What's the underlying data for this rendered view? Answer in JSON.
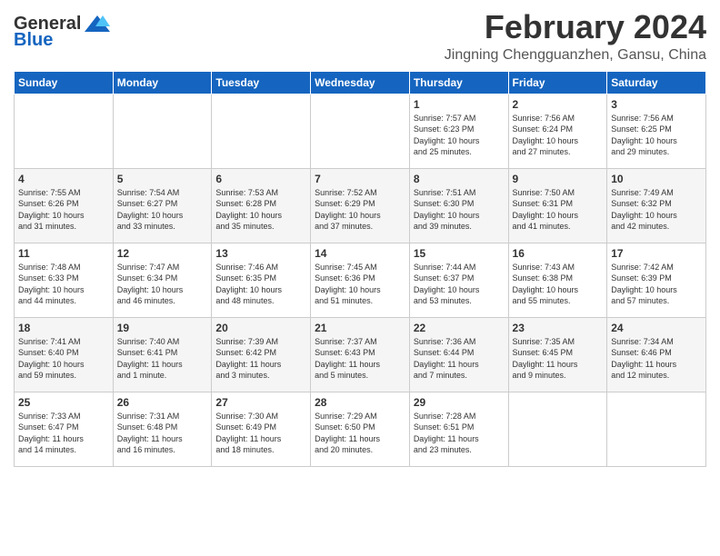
{
  "header": {
    "logo_line1": "General",
    "logo_line2": "Blue",
    "month_year": "February 2024",
    "location": "Jingning Chengguanzhen, Gansu, China"
  },
  "weekdays": [
    "Sunday",
    "Monday",
    "Tuesday",
    "Wednesday",
    "Thursday",
    "Friday",
    "Saturday"
  ],
  "weeks": [
    [
      {
        "day": "",
        "info": ""
      },
      {
        "day": "",
        "info": ""
      },
      {
        "day": "",
        "info": ""
      },
      {
        "day": "",
        "info": ""
      },
      {
        "day": "1",
        "info": "Sunrise: 7:57 AM\nSunset: 6:23 PM\nDaylight: 10 hours\nand 25 minutes."
      },
      {
        "day": "2",
        "info": "Sunrise: 7:56 AM\nSunset: 6:24 PM\nDaylight: 10 hours\nand 27 minutes."
      },
      {
        "day": "3",
        "info": "Sunrise: 7:56 AM\nSunset: 6:25 PM\nDaylight: 10 hours\nand 29 minutes."
      }
    ],
    [
      {
        "day": "4",
        "info": "Sunrise: 7:55 AM\nSunset: 6:26 PM\nDaylight: 10 hours\nand 31 minutes."
      },
      {
        "day": "5",
        "info": "Sunrise: 7:54 AM\nSunset: 6:27 PM\nDaylight: 10 hours\nand 33 minutes."
      },
      {
        "day": "6",
        "info": "Sunrise: 7:53 AM\nSunset: 6:28 PM\nDaylight: 10 hours\nand 35 minutes."
      },
      {
        "day": "7",
        "info": "Sunrise: 7:52 AM\nSunset: 6:29 PM\nDaylight: 10 hours\nand 37 minutes."
      },
      {
        "day": "8",
        "info": "Sunrise: 7:51 AM\nSunset: 6:30 PM\nDaylight: 10 hours\nand 39 minutes."
      },
      {
        "day": "9",
        "info": "Sunrise: 7:50 AM\nSunset: 6:31 PM\nDaylight: 10 hours\nand 41 minutes."
      },
      {
        "day": "10",
        "info": "Sunrise: 7:49 AM\nSunset: 6:32 PM\nDaylight: 10 hours\nand 42 minutes."
      }
    ],
    [
      {
        "day": "11",
        "info": "Sunrise: 7:48 AM\nSunset: 6:33 PM\nDaylight: 10 hours\nand 44 minutes."
      },
      {
        "day": "12",
        "info": "Sunrise: 7:47 AM\nSunset: 6:34 PM\nDaylight: 10 hours\nand 46 minutes."
      },
      {
        "day": "13",
        "info": "Sunrise: 7:46 AM\nSunset: 6:35 PM\nDaylight: 10 hours\nand 48 minutes."
      },
      {
        "day": "14",
        "info": "Sunrise: 7:45 AM\nSunset: 6:36 PM\nDaylight: 10 hours\nand 51 minutes."
      },
      {
        "day": "15",
        "info": "Sunrise: 7:44 AM\nSunset: 6:37 PM\nDaylight: 10 hours\nand 53 minutes."
      },
      {
        "day": "16",
        "info": "Sunrise: 7:43 AM\nSunset: 6:38 PM\nDaylight: 10 hours\nand 55 minutes."
      },
      {
        "day": "17",
        "info": "Sunrise: 7:42 AM\nSunset: 6:39 PM\nDaylight: 10 hours\nand 57 minutes."
      }
    ],
    [
      {
        "day": "18",
        "info": "Sunrise: 7:41 AM\nSunset: 6:40 PM\nDaylight: 10 hours\nand 59 minutes."
      },
      {
        "day": "19",
        "info": "Sunrise: 7:40 AM\nSunset: 6:41 PM\nDaylight: 11 hours\nand 1 minute."
      },
      {
        "day": "20",
        "info": "Sunrise: 7:39 AM\nSunset: 6:42 PM\nDaylight: 11 hours\nand 3 minutes."
      },
      {
        "day": "21",
        "info": "Sunrise: 7:37 AM\nSunset: 6:43 PM\nDaylight: 11 hours\nand 5 minutes."
      },
      {
        "day": "22",
        "info": "Sunrise: 7:36 AM\nSunset: 6:44 PM\nDaylight: 11 hours\nand 7 minutes."
      },
      {
        "day": "23",
        "info": "Sunrise: 7:35 AM\nSunset: 6:45 PM\nDaylight: 11 hours\nand 9 minutes."
      },
      {
        "day": "24",
        "info": "Sunrise: 7:34 AM\nSunset: 6:46 PM\nDaylight: 11 hours\nand 12 minutes."
      }
    ],
    [
      {
        "day": "25",
        "info": "Sunrise: 7:33 AM\nSunset: 6:47 PM\nDaylight: 11 hours\nand 14 minutes."
      },
      {
        "day": "26",
        "info": "Sunrise: 7:31 AM\nSunset: 6:48 PM\nDaylight: 11 hours\nand 16 minutes."
      },
      {
        "day": "27",
        "info": "Sunrise: 7:30 AM\nSunset: 6:49 PM\nDaylight: 11 hours\nand 18 minutes."
      },
      {
        "day": "28",
        "info": "Sunrise: 7:29 AM\nSunset: 6:50 PM\nDaylight: 11 hours\nand 20 minutes."
      },
      {
        "day": "29",
        "info": "Sunrise: 7:28 AM\nSunset: 6:51 PM\nDaylight: 11 hours\nand 23 minutes."
      },
      {
        "day": "",
        "info": ""
      },
      {
        "day": "",
        "info": ""
      }
    ]
  ]
}
